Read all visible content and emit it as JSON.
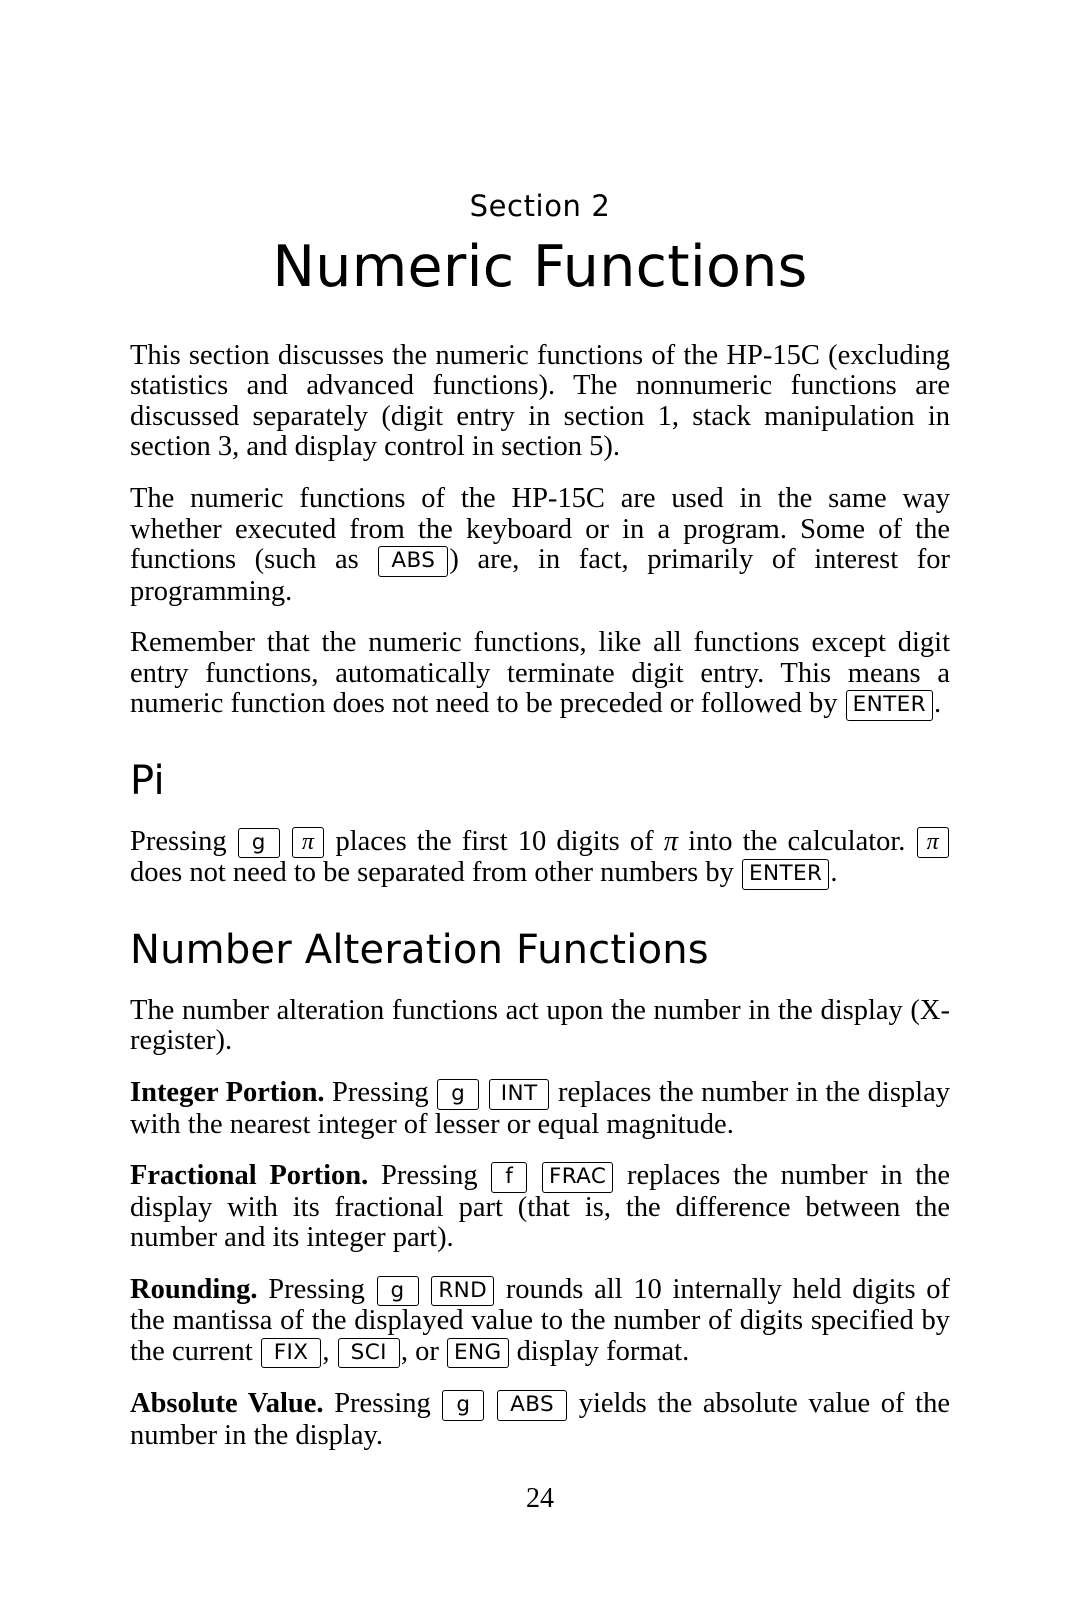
{
  "document": {
    "section_label": "Section 2",
    "title": "Numeric Functions",
    "page_number": "24"
  },
  "intro": {
    "para1_a": "This section discusses the numeric functions of the HP-15C (excluding statistics and advanced functions). The nonnumeric functions are discussed separately (digit entry in section 1, stack manipulation in section 3, and display control in section 5).",
    "para2_a": "The numeric functions of the HP-15C are used in the same way whether executed from the keyboard or in a program. Some of the functions (such as ",
    "para2_key": "ABS",
    "para2_b": ") are, in fact, primarily of interest for programming.",
    "para3_a": "Remember that the numeric functions, like all functions except digit entry functions, automatically terminate digit entry. This means a numeric function does not need to be preceded or followed by ",
    "para3_key": "ENTER",
    "para3_b": "."
  },
  "pi_section": {
    "heading": "Pi",
    "text_a": "Pressing ",
    "key_g": "g",
    "key_pi": "π",
    "text_b": " places the first 10 digits of ",
    "pi_symbol": "π",
    "text_c": " into the calculator. ",
    "key_pi2": "π",
    "text_d": " does not need to be separated from other numbers by ",
    "key_enter": "ENTER",
    "text_e": "."
  },
  "alteration_section": {
    "heading": "Number Alteration Functions",
    "intro": "The number alteration functions act upon the number in the display (X-register).",
    "items": [
      {
        "title": "Integer Portion.",
        "text_a": " Pressing ",
        "key1": "g",
        "key2": "INT",
        "text_b": " replaces the number in the display with the nearest integer of lesser or equal magnitude."
      },
      {
        "title": "Fractional Portion.",
        "text_a": " Pressing ",
        "key1": "f",
        "key2": "FRAC",
        "text_b": " replaces the number in the display with its fractional part (that is, the difference between the number and its integer part)."
      },
      {
        "title": "Rounding.",
        "text_a": " Pressing ",
        "key1": "g",
        "key2": "RND",
        "text_b": " rounds all 10 internally held digits of the mantissa of the displayed value to the number of digits specified by the current ",
        "key3": "FIX",
        "text_c": ", ",
        "key4": "SCI",
        "text_d": ", or ",
        "key5": "ENG",
        "text_e": " display format."
      },
      {
        "title": "Absolute Value.",
        "text_a": " Pressing ",
        "key1": "g",
        "key2": "ABS",
        "text_b": " yields the absolute value of the number in the display."
      }
    ]
  }
}
